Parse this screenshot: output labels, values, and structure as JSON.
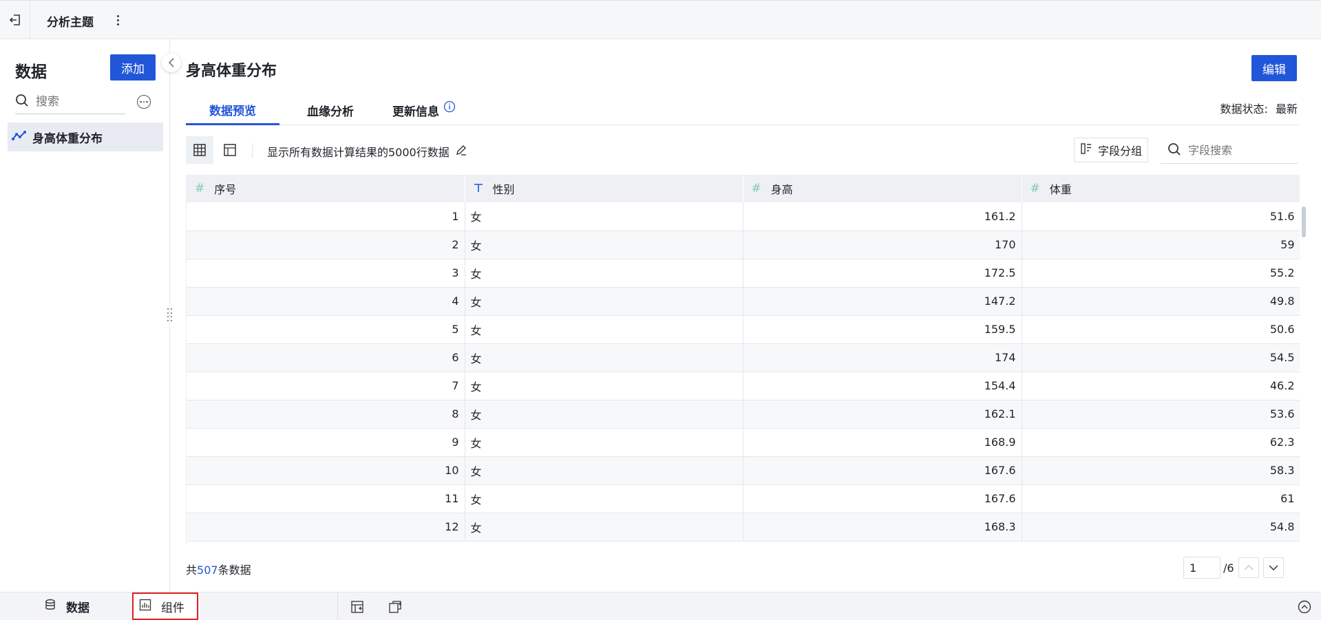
{
  "topbar": {
    "title": "分析主题"
  },
  "sidebar": {
    "title": "数据",
    "add_label": "添加",
    "search_placeholder": "搜索",
    "items": [
      {
        "label": "身高体重分布",
        "icon": "line-chart-icon"
      }
    ]
  },
  "main": {
    "title": "身高体重分布",
    "edit_label": "编辑",
    "tabs": [
      {
        "label": "数据预览",
        "active": true
      },
      {
        "label": "血缘分析",
        "active": false
      },
      {
        "label": "更新信息",
        "active": false,
        "icon": "info-icon"
      }
    ],
    "status_label": "数据状态:",
    "status_value": "最新",
    "toolbar": {
      "description": "显示所有数据计算结果的5000行数据",
      "group_label": "字段分组",
      "field_search_placeholder": "字段搜索"
    },
    "table": {
      "columns": [
        {
          "label": "序号",
          "type": "number"
        },
        {
          "label": "性别",
          "type": "text"
        },
        {
          "label": "身高",
          "type": "number"
        },
        {
          "label": "体重",
          "type": "number"
        }
      ],
      "rows": [
        [
          "1",
          "女",
          "161.2",
          "51.6"
        ],
        [
          "2",
          "女",
          "170",
          "59"
        ],
        [
          "3",
          "女",
          "172.5",
          "55.2"
        ],
        [
          "4",
          "女",
          "147.2",
          "49.8"
        ],
        [
          "5",
          "女",
          "159.5",
          "50.6"
        ],
        [
          "6",
          "女",
          "174",
          "54.5"
        ],
        [
          "7",
          "女",
          "154.4",
          "46.2"
        ],
        [
          "8",
          "女",
          "162.1",
          "53.6"
        ],
        [
          "9",
          "女",
          "168.9",
          "62.3"
        ],
        [
          "10",
          "女",
          "167.6",
          "58.3"
        ],
        [
          "11",
          "女",
          "167.6",
          "61"
        ],
        [
          "12",
          "女",
          "168.3",
          "54.8"
        ]
      ]
    },
    "footer": {
      "count_prefix": "共",
      "count": "507",
      "count_suffix": "条数据",
      "page": "1",
      "total_pages": "/6"
    }
  },
  "bottombar": {
    "data_label": "数据",
    "component_label": "组件"
  },
  "colors": {
    "accent": "#2156d9",
    "highlight_border": "#e02020"
  }
}
